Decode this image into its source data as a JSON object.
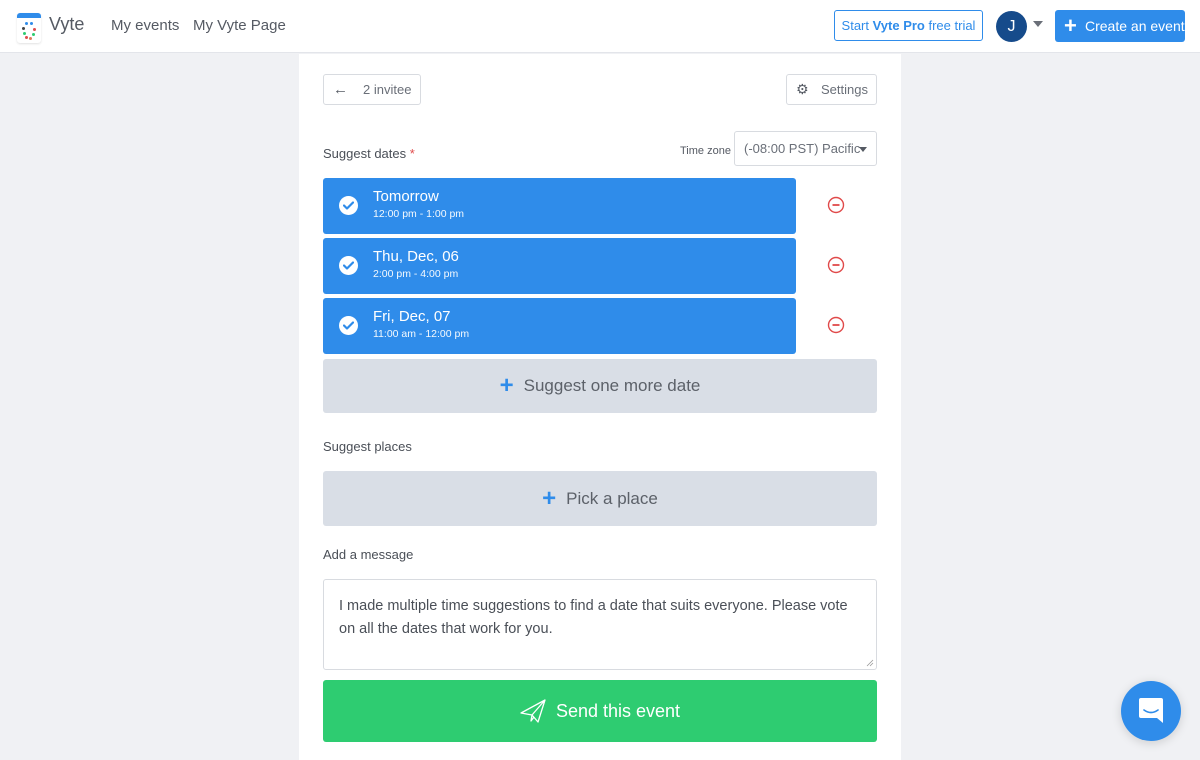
{
  "header": {
    "brand": "Vyte",
    "nav": [
      {
        "label": "My events"
      },
      {
        "label": "My Vyte Page"
      }
    ],
    "pro_trial": {
      "prefix": "Start ",
      "bold": "Vyte Pro",
      "suffix": " free trial"
    },
    "avatar_initial": "J",
    "create_label": "Create an event",
    "logo_icon": "calendar-logo-icon"
  },
  "toolbar": {
    "back_label": "2 invitee",
    "settings_label": "Settings"
  },
  "dates_section": {
    "label": "Suggest dates",
    "required_mark": "*",
    "timezone_label": "Time zone",
    "timezone_value": "(-08:00 PST) Pacific",
    "dates": [
      {
        "title": "Tomorrow",
        "time": "12:00 pm - 1:00 pm",
        "checked": true
      },
      {
        "title": "Thu, Dec, 06",
        "time": "2:00 pm - 4:00 pm",
        "checked": true
      },
      {
        "title": "Fri, Dec, 07",
        "time": "11:00 am - 12:00 pm",
        "checked": true
      }
    ],
    "add_date_label": "Suggest one more date"
  },
  "places_section": {
    "label": "Suggest places",
    "pick_place_label": "Pick a place"
  },
  "message_section": {
    "label": "Add a message",
    "value": "I made multiple time suggestions to find a date that suits everyone. Please vote on all the dates that work for you."
  },
  "send_label": "Send this event",
  "colors": {
    "primary": "#2f8cea",
    "success": "#2ecc71",
    "danger": "#e04a4a",
    "gray_button": "#d9dee6",
    "avatar": "#164b8b"
  }
}
